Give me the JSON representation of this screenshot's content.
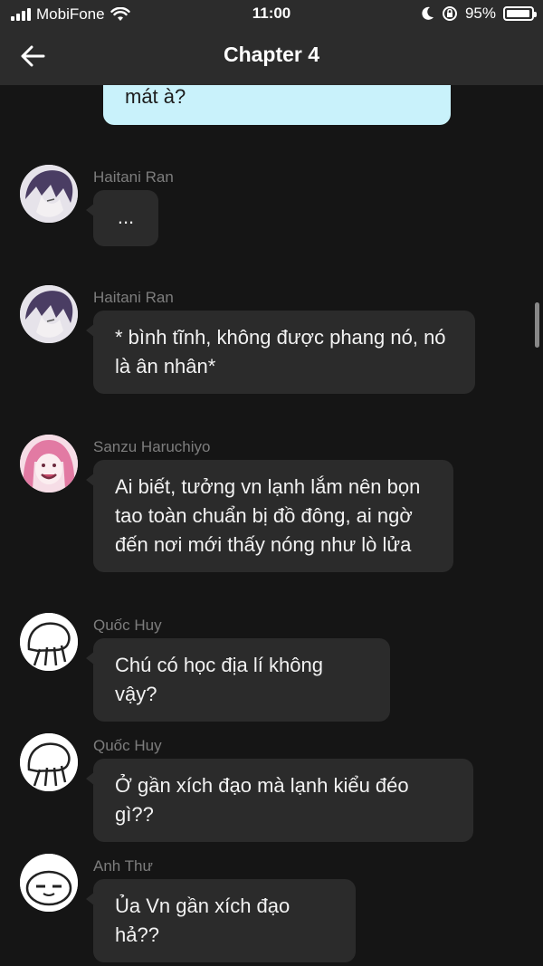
{
  "status_bar": {
    "carrier": "MobiFone",
    "time": "11:00",
    "battery": "95%",
    "battery_level": 0.95
  },
  "header": {
    "title": "Chapter 4"
  },
  "previous_message": {
    "text": "mát à?"
  },
  "messages": [
    {
      "sender": "Haitani Ran",
      "text": "...",
      "avatar": "purple-hair-avatar"
    },
    {
      "sender": "Haitani Ran",
      "text": "* bình tĩnh, không được phang nó, nó là ân nhân*",
      "avatar": "purple-hair-avatar"
    },
    {
      "sender": "Sanzu Haruchiyo",
      "text": "Ai biết, tưởng vn lạnh lắm nên bọn tao toàn chuẩn bị đồ đông, ai ngờ đến nơi mới thấy nóng như lò lửa",
      "avatar": "pink-hair-avatar"
    },
    {
      "sender": "Quốc Huy",
      "text": "Chú có học địa lí không vậy?",
      "avatar": "doodle-face-avatar"
    },
    {
      "sender": "Quốc Huy",
      "text": "Ở gần xích đạo mà lạnh kiểu đéo gì??",
      "avatar": "doodle-face-avatar"
    },
    {
      "sender": "Anh Thư",
      "text": "Ủa Vn gần xích đạo hả??",
      "avatar": "dango-face-avatar"
    }
  ]
}
